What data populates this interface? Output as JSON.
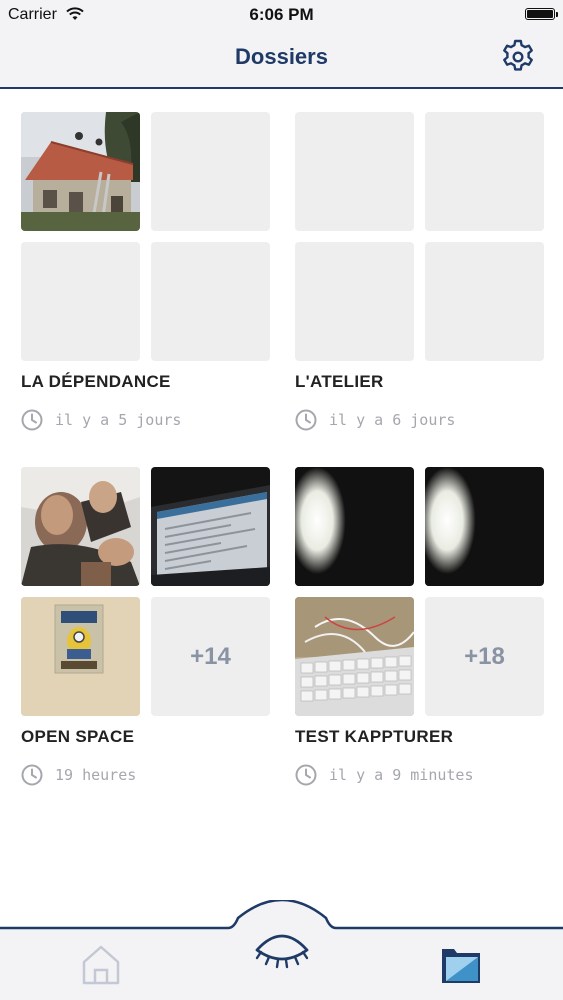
{
  "status_bar": {
    "carrier": "Carrier",
    "time": "6:06 PM"
  },
  "nav": {
    "title": "Dossiers",
    "settings_icon": "gear-icon"
  },
  "folders": [
    {
      "title": "LA DÉPENDANCE",
      "time": "il y a 5 jours",
      "more": ""
    },
    {
      "title": "L'ATELIER",
      "time": "il y a 6 jours",
      "more": ""
    },
    {
      "title": "OPEN SPACE",
      "time": "19 heures",
      "more": "+14"
    },
    {
      "title": "TEST KAPPTURER",
      "time": "il y a 9 minutes",
      "more": "+18"
    }
  ],
  "tab_bar": {
    "items": [
      "home-icon",
      "eye-icon",
      "folders-icon"
    ],
    "active": "folders-icon"
  },
  "colors": {
    "accent": "#1f3a66",
    "active_tab": "#2f7fb8",
    "placeholder": "#eeeeef",
    "muted_text": "#a4a7ad"
  }
}
